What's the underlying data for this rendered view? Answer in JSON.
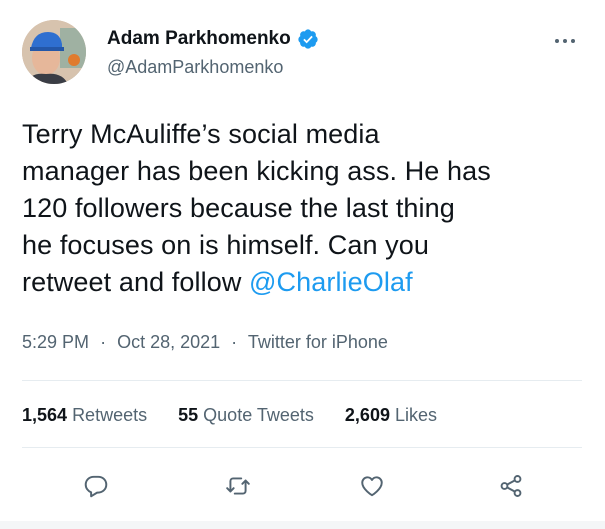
{
  "author": {
    "name": "Adam Parkhomenko",
    "handle": "@AdamParkhomenko",
    "verified": true
  },
  "tweet": {
    "text_before_mention": "Terry McAuliffe’s social media\nmanager has been kicking ass. He has\n120 followers because the last thing\nhe focuses on is himself. Can you\nretweet and follow ",
    "mention": "@CharlieOlaf",
    "time": "5:29 PM",
    "date": "Oct 28, 2021",
    "source": "Twitter for iPhone",
    "separator": "·"
  },
  "stats": {
    "retweets_count": "1,564",
    "retweets_label": "Retweets",
    "quotes_count": "55",
    "quotes_label": "Quote Tweets",
    "likes_count": "2,609",
    "likes_label": "Likes"
  },
  "icons": {
    "more": "more-horizontal-icon",
    "reply": "reply-icon",
    "retweet": "retweet-icon",
    "like": "heart-icon",
    "share": "share-icon",
    "verified": "verified-badge-icon"
  },
  "colors": {
    "accent": "#1d9bf0",
    "text": "#0f1419",
    "muted": "#536471",
    "divider": "#e6ecf0"
  }
}
